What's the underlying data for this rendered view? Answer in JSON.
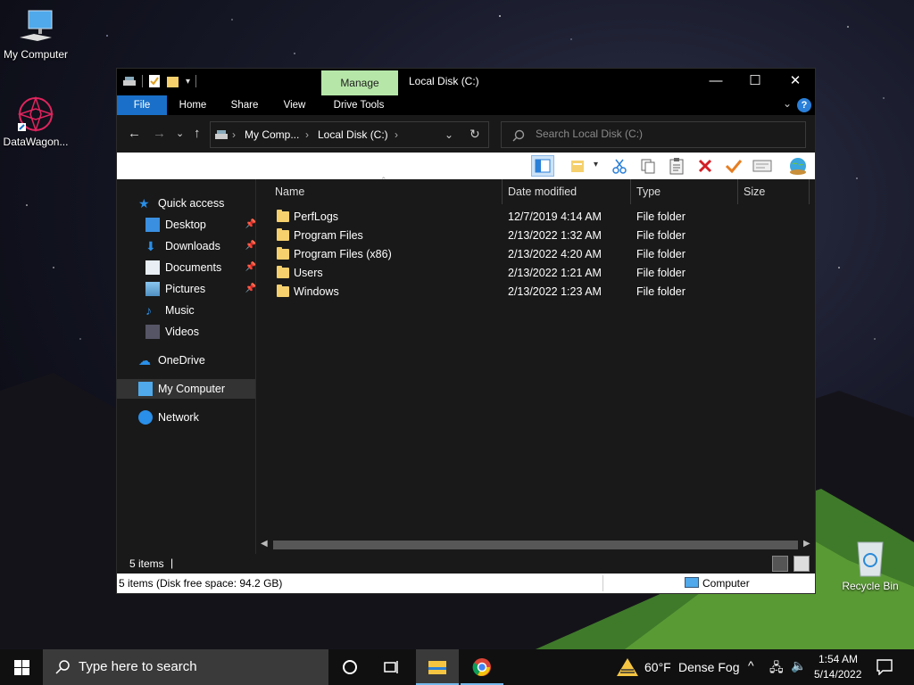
{
  "desktop": {
    "icons": [
      {
        "label": "My Computer",
        "icon": "computer-icon"
      },
      {
        "label": "DataWagon...",
        "icon": "datawagon-icon"
      },
      {
        "label": "Recycle Bin",
        "icon": "recycle-bin-icon"
      }
    ]
  },
  "window": {
    "title": "Local Disk (C:)",
    "contextual_tab": "Manage",
    "ribbon_tabs": [
      "File",
      "Home",
      "Share",
      "View",
      "Drive Tools"
    ],
    "controls": {
      "minimize": "—",
      "maximize": "☐",
      "close": "✕",
      "help": "?"
    },
    "address": {
      "segments": [
        "My Comp...",
        "Local Disk (C:)"
      ]
    },
    "search": {
      "placeholder": "Search Local Disk (C:)"
    },
    "toolbar_icons": [
      "layout-icon",
      "new-folder-icon",
      "cut-icon",
      "copy-icon",
      "paste-icon",
      "delete-icon",
      "checkmark-icon",
      "properties-icon",
      "globe-icon"
    ],
    "nav": {
      "quick_access": "Quick access",
      "items": [
        {
          "label": "Desktop",
          "icon": "desktop-icon",
          "pinned": true
        },
        {
          "label": "Downloads",
          "icon": "downloads-icon",
          "pinned": true
        },
        {
          "label": "Documents",
          "icon": "documents-icon",
          "pinned": true
        },
        {
          "label": "Pictures",
          "icon": "pictures-icon",
          "pinned": true
        },
        {
          "label": "Music",
          "icon": "music-icon",
          "pinned": false
        },
        {
          "label": "Videos",
          "icon": "videos-icon",
          "pinned": false
        }
      ],
      "onedrive": "OneDrive",
      "my_computer": "My Computer",
      "network": "Network"
    },
    "columns": {
      "name": "Name",
      "date": "Date modified",
      "type": "Type",
      "size": "Size"
    },
    "files": [
      {
        "name": "PerfLogs",
        "date": "12/7/2019 4:14 AM",
        "type": "File folder"
      },
      {
        "name": "Program Files",
        "date": "2/13/2022 1:32 AM",
        "type": "File folder"
      },
      {
        "name": "Program Files (x86)",
        "date": "2/13/2022 4:20 AM",
        "type": "File folder"
      },
      {
        "name": "Users",
        "date": "2/13/2022 1:21 AM",
        "type": "File folder"
      },
      {
        "name": "Windows",
        "date": "2/13/2022 1:23 AM",
        "type": "File folder"
      }
    ],
    "status": {
      "items": "5 items",
      "cursor": "|"
    },
    "bottom_bar": {
      "left": "5 items (Disk free space: 94.2 GB)",
      "right": "Computer"
    }
  },
  "taskbar": {
    "search_placeholder": "Type here to search",
    "weather": {
      "temp": "60°F",
      "condition": "Dense Fog"
    },
    "clock": {
      "time": "1:54 AM",
      "date": "5/14/2022"
    }
  },
  "colors": {
    "accent": "#1a70c8",
    "manage_tab": "#b6e7a8",
    "folder": "#f5d06d",
    "window_bg": "#191919"
  }
}
